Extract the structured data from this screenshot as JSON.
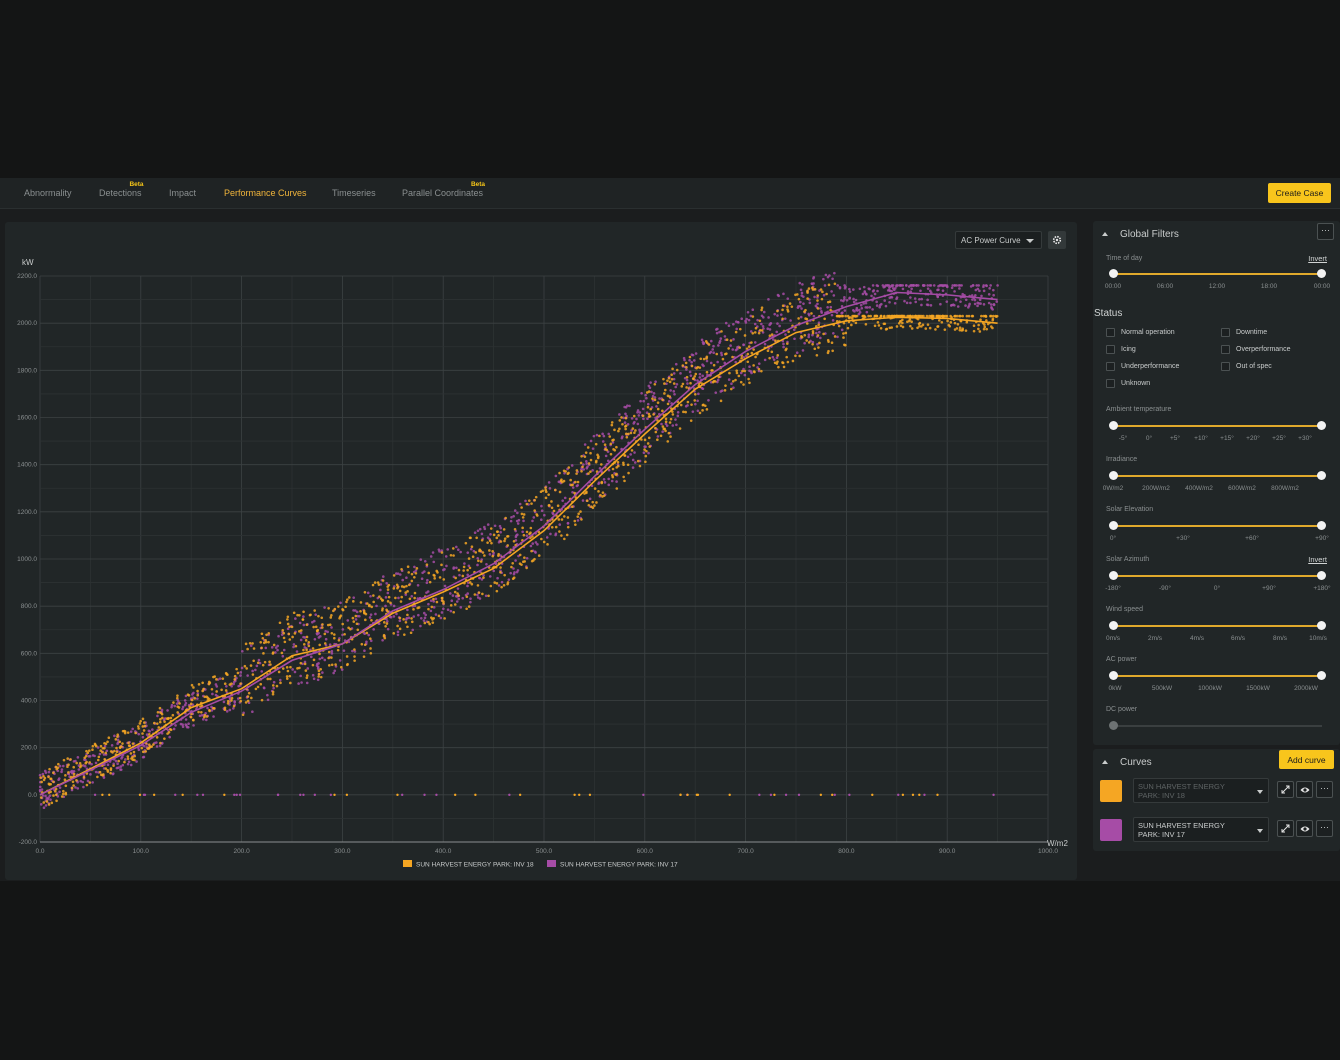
{
  "nav": {
    "tabs": [
      {
        "label": "Abnormality",
        "beta": ""
      },
      {
        "label": "Detections",
        "beta": "Beta"
      },
      {
        "label": "Impact",
        "beta": ""
      },
      {
        "label": "Performance Curves",
        "beta": ""
      },
      {
        "label": "Timeseries",
        "beta": ""
      },
      {
        "label": "Parallel Coordinates",
        "beta": "Beta"
      }
    ],
    "active": "Performance Curves",
    "create_case_label": "Create Case"
  },
  "chart_panel": {
    "selector_value": "AC Power Curve",
    "settings_icon": "gear-icon"
  },
  "chart_data": {
    "type": "scatter",
    "title": "",
    "xlabel": "W/m2",
    "ylabel": "kW",
    "xlim": [
      0,
      1000
    ],
    "ylim": [
      -200,
      2200
    ],
    "xticks": [
      "0.0",
      "100.0",
      "200.0",
      "300.0",
      "400.0",
      "500.0",
      "600.0",
      "700.0",
      "800.0",
      "900.0",
      "1000.0"
    ],
    "yticks": [
      "-200.0",
      "0.0",
      "200.0",
      "400.0",
      "600.0",
      "800.0",
      "1000.0",
      "1200.0",
      "1400.0",
      "1600.0",
      "1800.0",
      "2000.0",
      "2200.0"
    ],
    "grid": true,
    "legend_position": "bottom-center",
    "series": [
      {
        "name": "SUN HARVEST ENERGY PARK: INV 18",
        "color": "#f5a623",
        "curve_x": [
          0,
          50,
          100,
          150,
          200,
          250,
          300,
          350,
          400,
          450,
          500,
          550,
          600,
          650,
          700,
          750,
          800,
          850,
          900,
          950
        ],
        "curve_y": [
          0,
          110,
          220,
          370,
          450,
          590,
          640,
          770,
          860,
          960,
          1120,
          1330,
          1530,
          1720,
          1850,
          1960,
          2010,
          2025,
          2020,
          2000
        ]
      },
      {
        "name": "SUN HARVEST ENERGY PARK: INV 17",
        "color": "#a64ca6",
        "curve_x": [
          0,
          50,
          100,
          150,
          200,
          250,
          300,
          350,
          400,
          450,
          500,
          550,
          600,
          650,
          700,
          750,
          800,
          850,
          900,
          950
        ],
        "curve_y": [
          0,
          105,
          210,
          350,
          440,
          570,
          640,
          780,
          870,
          980,
          1140,
          1350,
          1550,
          1740,
          1880,
          1990,
          2070,
          2130,
          2120,
          2100
        ]
      }
    ]
  },
  "filters": {
    "title": "Global Filters",
    "menu_icon": "more-icon",
    "time_of_day": {
      "label": "Time of day",
      "invert": "Invert",
      "ticks": [
        "00:00",
        "06:00",
        "12:00",
        "18:00",
        "00:00"
      ]
    },
    "status": {
      "title": "Status",
      "options": [
        "Normal operation",
        "Downtime",
        "Icing",
        "Overperformance",
        "Underperformance",
        "Out of spec",
        "Unknown"
      ]
    },
    "ambient_temperature": {
      "label": "Ambient temperature",
      "ticks": [
        "-5°",
        "0°",
        "+5°",
        "+10°",
        "+15°",
        "+20°",
        "+25°",
        "+30°"
      ]
    },
    "irradiance": {
      "label": "Irradiance",
      "ticks": [
        "0W/m2",
        "200W/m2",
        "400W/m2",
        "600W/m2",
        "800W/m2"
      ]
    },
    "solar_elevation": {
      "label": "Solar Elevation",
      "ticks": [
        "0°",
        "+30°",
        "+60°",
        "+90°"
      ]
    },
    "solar_azimuth": {
      "label": "Solar Azimuth",
      "invert": "Invert",
      "ticks": [
        "-180°",
        "-90°",
        "0°",
        "+90°",
        "+180°"
      ]
    },
    "wind_speed": {
      "label": "Wind speed",
      "ticks": [
        "0m/s",
        "2m/s",
        "4m/s",
        "6m/s",
        "8m/s",
        "10m/s"
      ]
    },
    "ac_power": {
      "label": "AC power",
      "ticks": [
        "0kW",
        "500kW",
        "1000kW",
        "1500kW",
        "2000kW"
      ]
    },
    "dc_power": {
      "label": "DC power"
    }
  },
  "curves": {
    "title": "Curves",
    "add_label": "Add curve",
    "items": [
      {
        "line1": "SUN HARVEST ENERGY",
        "line2": "PARK: INV 18",
        "color": "#f5a623"
      },
      {
        "line1": "SUN HARVEST ENERGY",
        "line2": "PARK: INV 17",
        "color": "#a64ca6"
      }
    ]
  }
}
